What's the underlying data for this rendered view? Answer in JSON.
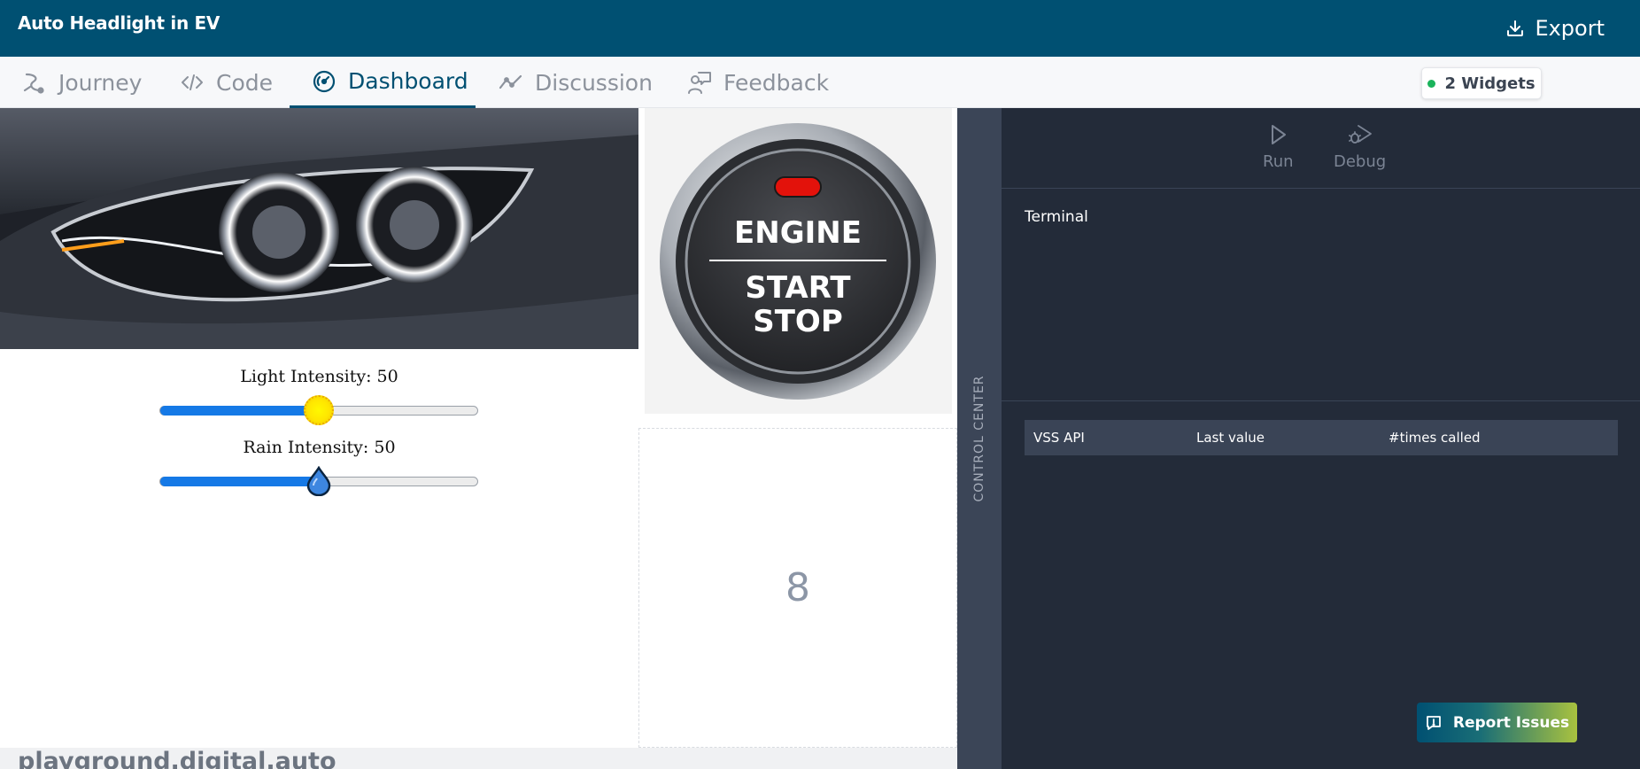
{
  "header": {
    "title": "Auto Headlight in EV",
    "export_label": "Export",
    "bg_color": "#005072"
  },
  "tabs": [
    {
      "label": "Journey",
      "icon": "journey-icon",
      "active": false
    },
    {
      "label": "Code",
      "icon": "code-icon",
      "active": false
    },
    {
      "label": "Dashboard",
      "icon": "dashboard-gauge-icon",
      "active": true
    },
    {
      "label": "Discussion",
      "icon": "discussion-chart-icon",
      "active": false
    },
    {
      "label": "Feedback",
      "icon": "feedback-icon",
      "active": false
    }
  ],
  "widgets_badge": {
    "label": "2 Widgets",
    "status_color": "#1bb35b"
  },
  "headlight_widget": {
    "image": "car-headlight-photo",
    "light": {
      "label": "Light Intensity: 50",
      "value": 50,
      "max": 100,
      "thumb_icon": "sun-icon"
    },
    "rain": {
      "label": "Rain Intensity: 50",
      "value": 50,
      "max": 100,
      "thumb_icon": "water-drop-icon"
    }
  },
  "engine_button": {
    "line1": "ENGINE",
    "line2": "START",
    "line3": "STOP",
    "indicator_color": "#e3120b"
  },
  "counter": {
    "value": "8"
  },
  "control_center": {
    "label": "CONTROL CENTER",
    "run_label": "Run",
    "debug_label": "Debug",
    "terminal_label": "Terminal",
    "table_headers": [
      "VSS API",
      "Last value",
      "#times called"
    ]
  },
  "report_issues": {
    "label": "Report Issues"
  },
  "footer": {
    "text": "playground.digital.auto"
  }
}
